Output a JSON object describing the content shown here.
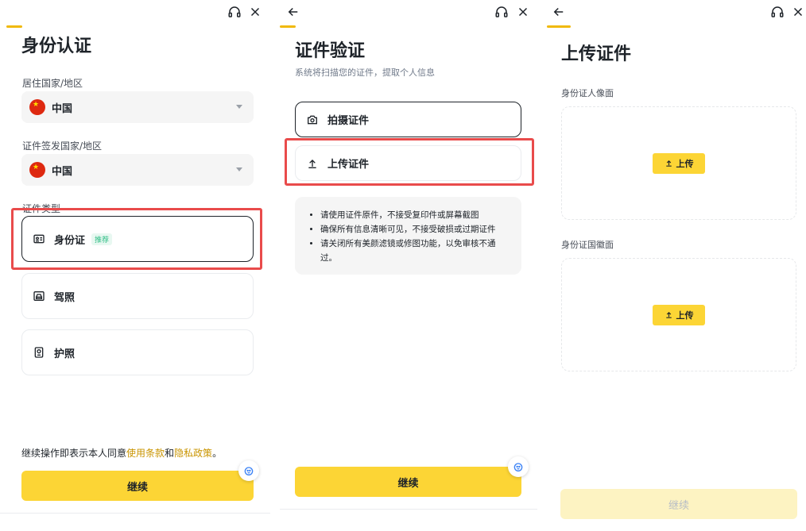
{
  "panel1": {
    "title": "身份认证",
    "residence_label": "居住国家/地区",
    "residence_value": "中国",
    "issuing_label": "证件签发国家/地区",
    "issuing_value": "中国",
    "doc_type_label": "证件类型",
    "options": [
      {
        "label": "身份证",
        "badge": "推荐",
        "icon": "id-card-icon"
      },
      {
        "label": "驾照",
        "icon": "drivers-license-icon"
      },
      {
        "label": "护照",
        "icon": "passport-icon"
      }
    ],
    "consent_prefix": "继续操作即表示本人同意",
    "consent_terms": "使用条款",
    "consent_and": "和",
    "consent_privacy": "隐私政策",
    "consent_suffix": "。",
    "continue_label": "继续"
  },
  "panel2": {
    "title": "证件验证",
    "subtitle": "系统将扫描您的证件，提取个人信息",
    "options": [
      {
        "label": "拍摄证件",
        "icon": "camera-icon"
      },
      {
        "label": "上传证件",
        "icon": "upload-icon"
      }
    ],
    "tips": [
      "请使用证件原件，不接受复印件或屏幕截图",
      "确保所有信息清晰可见，不接受破损或过期证件",
      "请关闭所有美颜滤镜或修图功能，以免审核不通过。"
    ],
    "continue_label": "继续"
  },
  "panel3": {
    "title": "上传证件",
    "front_label": "身份证人像面",
    "back_label": "身份证国徽面",
    "upload_label": "上传",
    "continue_label": "继续"
  },
  "colors": {
    "accent": "#fcd535",
    "highlight": "#e94b4b",
    "link": "#c99400",
    "badge_green": "#2ebd85"
  }
}
